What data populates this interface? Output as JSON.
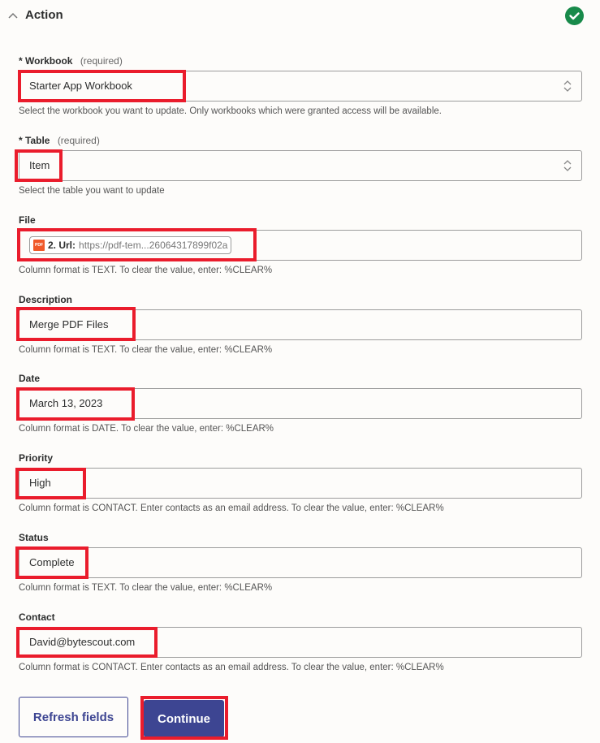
{
  "header": {
    "title": "Action",
    "collapse_icon": "chevron-up-icon",
    "status_icon": "check-circle-icon",
    "status_color": "#188a4a"
  },
  "fields": {
    "workbook": {
      "label": "Workbook",
      "required_prefix": "*",
      "required_note": "(required)",
      "value": "Starter App Workbook",
      "help": "Select the workbook you want to update. Only workbooks which were granted access will be available."
    },
    "table": {
      "label": "Table",
      "required_prefix": "*",
      "required_note": "(required)",
      "value": "Item",
      "help": "Select the table you want to update"
    },
    "file": {
      "label": "File",
      "pill_icon": "PDF",
      "pill_key": "2. Url:",
      "pill_value": "https://pdf-tem...26064317899f02a",
      "help": "Column format is TEXT. To clear the value, enter: %CLEAR%"
    },
    "description": {
      "label": "Description",
      "value": "Merge PDF Files",
      "help": "Column format is TEXT. To clear the value, enter: %CLEAR%"
    },
    "date": {
      "label": "Date",
      "value": "March 13, 2023",
      "help": "Column format is DATE. To clear the value, enter: %CLEAR%"
    },
    "priority": {
      "label": "Priority",
      "value": "High",
      "help": "Column format is CONTACT. Enter contacts as an email address. To clear the value, enter: %CLEAR%"
    },
    "status": {
      "label": "Status",
      "value": "Complete",
      "help": "Column format is TEXT. To clear the value, enter: %CLEAR%"
    },
    "contact": {
      "label": "Contact",
      "value": "David@bytescout.com",
      "help": "Column format is CONTACT. Enter contacts as an email address. To clear the value, enter: %CLEAR%"
    }
  },
  "buttons": {
    "refresh_label": "Refresh fields",
    "continue_label": "Continue"
  },
  "colors": {
    "primary": "#3d4592",
    "highlight": "#ea1c2c",
    "success": "#188a4a"
  }
}
